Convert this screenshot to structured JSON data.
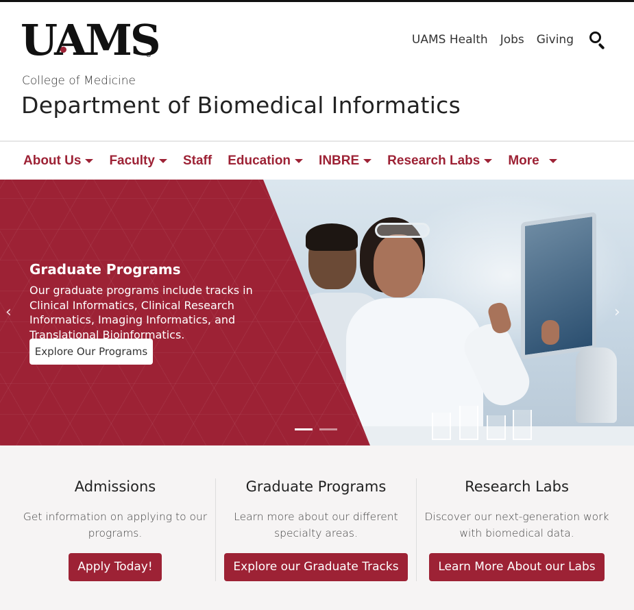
{
  "header": {
    "logo_text": "UAMS",
    "college": "College of Medicine",
    "department": "Department of Biomedical Informatics"
  },
  "utility_nav": {
    "items": [
      "UAMS Health",
      "Jobs",
      "Giving"
    ],
    "search_icon": "search-icon"
  },
  "main_nav": {
    "items": [
      {
        "label": "About Us",
        "has_dropdown": true
      },
      {
        "label": "Faculty",
        "has_dropdown": true
      },
      {
        "label": "Staff",
        "has_dropdown": false
      },
      {
        "label": "Education",
        "has_dropdown": true
      },
      {
        "label": "INBRE",
        "has_dropdown": true
      },
      {
        "label": "Research Labs",
        "has_dropdown": true
      },
      {
        "label": "More",
        "has_dropdown": true
      }
    ]
  },
  "hero": {
    "title": "Graduate Programs",
    "text": "Our graduate programs include tracks in Clinical Informatics, Clinical Research Informatics, Imaging Informatics, and Translational Bioinformatics.",
    "button_label": "Explore Our Programs",
    "slide_count": 2,
    "active_slide": 1
  },
  "cards": [
    {
      "title": "Admissions",
      "text": "Get information on applying to our programs.",
      "button_label": "Apply Today!"
    },
    {
      "title": "Graduate Programs",
      "text": "Learn more about our different specialty areas.",
      "button_label": "Explore our Graduate Tracks"
    },
    {
      "title": "Research Labs",
      "text": "Discover our next-generation work with biomedical data.",
      "button_label": "Learn More About our Labs"
    }
  ],
  "colors": {
    "brand": "#9d2235",
    "card_background": "#f6f4f4"
  }
}
